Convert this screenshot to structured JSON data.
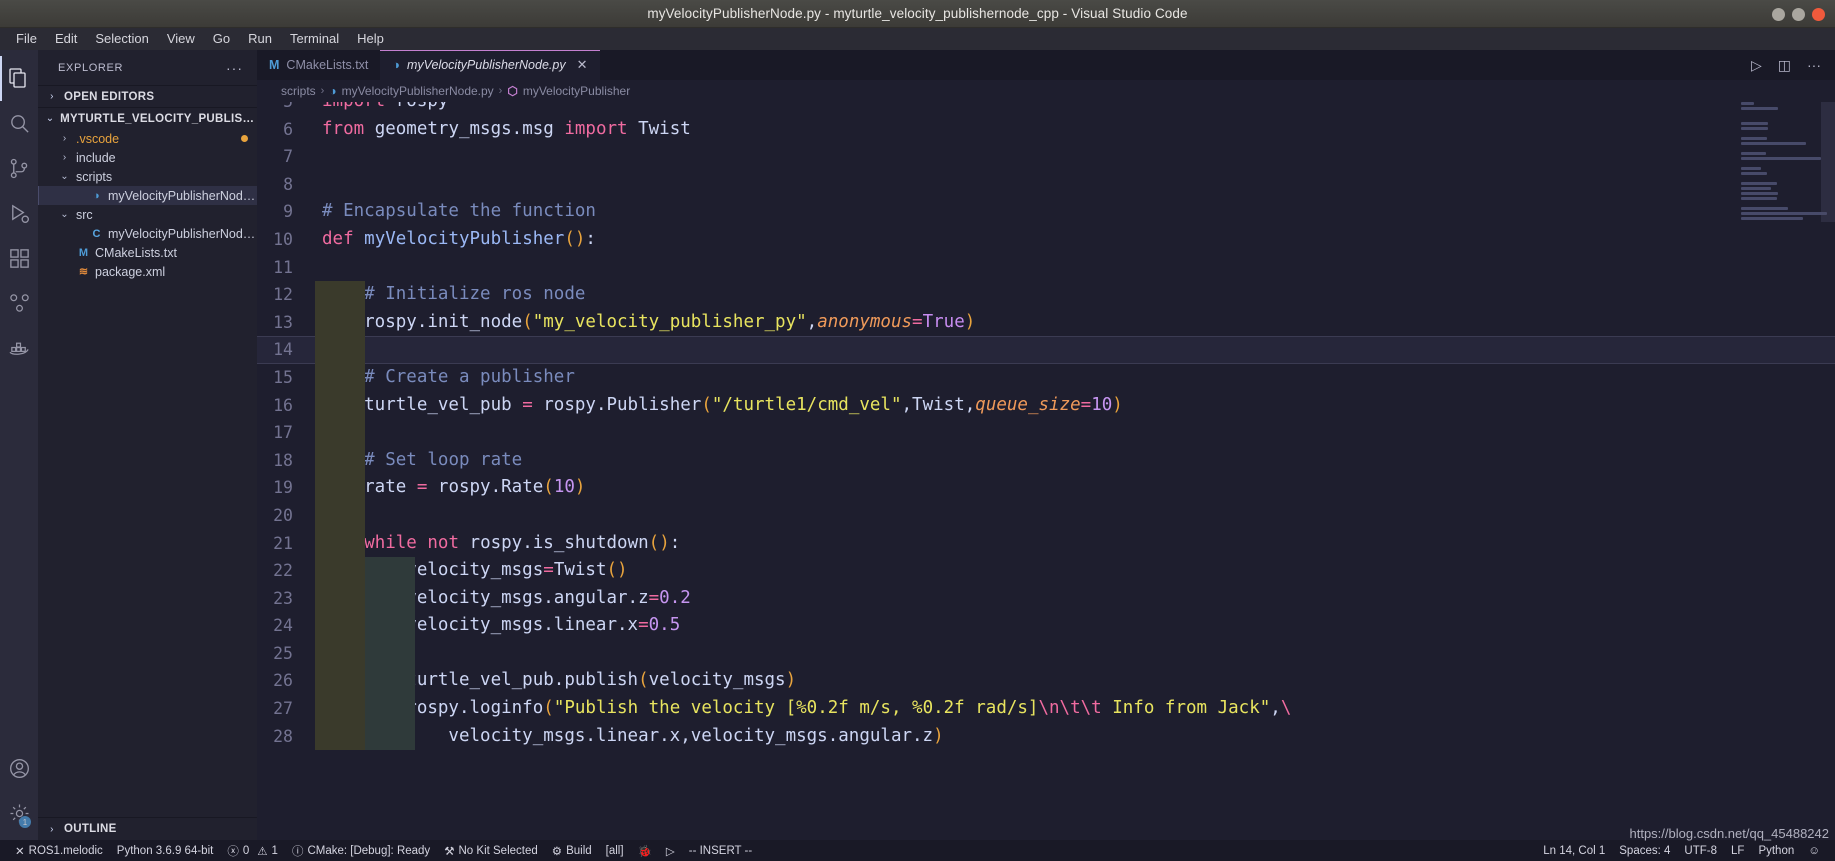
{
  "window": {
    "title": "myVelocityPublisherNode.py - myturtle_velocity_publishernode_cpp - Visual Studio Code",
    "controls": {
      "minimize": "minimize-icon",
      "maximize": "maximize-icon",
      "close": "close-icon"
    }
  },
  "menubar": {
    "items": [
      "File",
      "Edit",
      "Selection",
      "View",
      "Go",
      "Run",
      "Terminal",
      "Help"
    ]
  },
  "activitybar": {
    "items": [
      {
        "name": "explorer",
        "icon": "files-icon",
        "active": true
      },
      {
        "name": "search",
        "icon": "search-icon",
        "active": false
      },
      {
        "name": "source-control",
        "icon": "source-control-icon",
        "active": false
      },
      {
        "name": "run-and-debug",
        "icon": "run-debug-icon",
        "active": false
      },
      {
        "name": "extensions",
        "icon": "extensions-icon",
        "active": false
      },
      {
        "name": "ros",
        "icon": "ros-icon",
        "active": false
      },
      {
        "name": "docker",
        "icon": "docker-icon",
        "active": false
      }
    ],
    "bottom": [
      {
        "name": "accounts",
        "icon": "account-icon"
      },
      {
        "name": "settings",
        "icon": "gear-icon",
        "badge": "1"
      }
    ]
  },
  "sidebar": {
    "title": "EXPLORER",
    "more_label": "···",
    "sections": [
      {
        "label": "OPEN EDITORS",
        "twisty": "›",
        "expanded": false
      },
      {
        "label": "MYTURTLE_VELOCITY_PUBLISHERNODE_...",
        "twisty": "⌄",
        "expanded": true
      }
    ],
    "tree": [
      {
        "label": ".vscode",
        "type": "folder",
        "twisty": "›",
        "depth": 1,
        "icon": "folder-icon",
        "color": "#e8a33d",
        "modified": true
      },
      {
        "label": "include",
        "type": "folder",
        "twisty": "›",
        "depth": 1,
        "icon": "folder-icon",
        "color": "#cdd0df",
        "modified": false
      },
      {
        "label": "scripts",
        "type": "folder",
        "twisty": "⌄",
        "depth": 1,
        "icon": "folder-icon",
        "color": "#cdd0df",
        "modified": false
      },
      {
        "label": "myVelocityPublisherNode.py",
        "type": "file",
        "depth": 2,
        "icon": "python-icon",
        "color": "#4e9bd6",
        "selected": true
      },
      {
        "label": "src",
        "type": "folder",
        "twisty": "⌄",
        "depth": 1,
        "icon": "folder-icon",
        "color": "#cdd0df",
        "modified": false
      },
      {
        "label": "myVelocityPublisherNode.cpp",
        "type": "file",
        "depth": 2,
        "icon": "cpp-icon",
        "color": "#59a6e0",
        "selected": false
      },
      {
        "label": "CMakeLists.txt",
        "type": "file",
        "depth": 1,
        "icon": "cmake-icon",
        "color": "#4e9bd6",
        "selected": false
      },
      {
        "label": "package.xml",
        "type": "file",
        "depth": 1,
        "icon": "xml-icon",
        "color": "#e08a3c",
        "selected": false
      }
    ],
    "outline": {
      "label": "OUTLINE",
      "twisty": "›"
    }
  },
  "tabs": [
    {
      "label": "CMakeLists.txt",
      "icon": "cmake-icon",
      "icon_glyph": "M",
      "icon_color": "#4e9bd6",
      "active": false,
      "closable": false
    },
    {
      "label": "myVelocityPublisherNode.py",
      "icon": "python-icon",
      "icon_glyph": "◑",
      "icon_color": "#4e9bd6",
      "active": true,
      "closable": true,
      "close_glyph": "✕"
    }
  ],
  "editor_actions": [
    {
      "name": "run-python-file",
      "glyph": "▷"
    },
    {
      "name": "split-editor",
      "glyph": "◫"
    },
    {
      "name": "more-actions",
      "glyph": "···"
    }
  ],
  "breadcrumb": [
    {
      "label": "scripts",
      "icon": null
    },
    {
      "label": "myVelocityPublisherNode.py",
      "icon": "python-icon"
    },
    {
      "label": "myVelocityPublisher",
      "icon": "symbol-method-icon"
    }
  ],
  "breadcrumb_separator": "›",
  "code": {
    "first_visible_line": 5,
    "cursor_line": 14,
    "lines": [
      {
        "n": 5,
        "indent": 0,
        "partial": true,
        "tokens": [
          {
            "t": "import",
            "c": "kw"
          },
          {
            "t": " ",
            "c": "var"
          },
          {
            "t": "rospy",
            "c": "var"
          }
        ]
      },
      {
        "n": 6,
        "indent": 0,
        "tokens": [
          {
            "t": "from",
            "c": "kw"
          },
          {
            "t": " geometry_msgs.msg ",
            "c": "var"
          },
          {
            "t": "import",
            "c": "kw"
          },
          {
            "t": " ",
            "c": "var"
          },
          {
            "t": "Twist",
            "c": "var"
          }
        ]
      },
      {
        "n": 7,
        "indent": 0,
        "tokens": []
      },
      {
        "n": 8,
        "indent": 0,
        "tokens": []
      },
      {
        "n": 9,
        "indent": 0,
        "tokens": [
          {
            "t": "# Encapsulate the function",
            "c": "cmt"
          }
        ]
      },
      {
        "n": 10,
        "indent": 0,
        "tokens": [
          {
            "t": "def",
            "c": "kw"
          },
          {
            "t": " ",
            "c": "var"
          },
          {
            "t": "myVelocityPublisher",
            "c": "fn"
          },
          {
            "t": "()",
            "c": "par"
          },
          {
            "t": ":",
            "c": "var"
          }
        ]
      },
      {
        "n": 11,
        "indent": 0,
        "tokens": []
      },
      {
        "n": 12,
        "indent": 1,
        "tokens": [
          {
            "t": "    ",
            "c": "var"
          },
          {
            "t": "# Initialize ros node",
            "c": "cmt"
          }
        ]
      },
      {
        "n": 13,
        "indent": 1,
        "tokens": [
          {
            "t": "    rospy.init_node",
            "c": "var"
          },
          {
            "t": "(",
            "c": "par"
          },
          {
            "t": "\"my_velocity_publisher_py\"",
            "c": "str"
          },
          {
            "t": ",",
            "c": "var"
          },
          {
            "t": "anonymous",
            "c": "parm"
          },
          {
            "t": "=",
            "c": "op"
          },
          {
            "t": "True",
            "c": "kw2"
          },
          {
            "t": ")",
            "c": "par"
          }
        ]
      },
      {
        "n": 14,
        "indent": 1,
        "current": true,
        "tokens": []
      },
      {
        "n": 15,
        "indent": 1,
        "tokens": [
          {
            "t": "    ",
            "c": "var"
          },
          {
            "t": "# Create a publisher",
            "c": "cmt"
          }
        ]
      },
      {
        "n": 16,
        "indent": 1,
        "tokens": [
          {
            "t": "    turtle_vel_pub ",
            "c": "var"
          },
          {
            "t": "=",
            "c": "op"
          },
          {
            "t": " rospy.Publisher",
            "c": "var"
          },
          {
            "t": "(",
            "c": "par"
          },
          {
            "t": "\"/turtle1/cmd_vel\"",
            "c": "str"
          },
          {
            "t": ",Twist,",
            "c": "var"
          },
          {
            "t": "queue_size",
            "c": "parm"
          },
          {
            "t": "=",
            "c": "op"
          },
          {
            "t": "10",
            "c": "num"
          },
          {
            "t": ")",
            "c": "par"
          }
        ]
      },
      {
        "n": 17,
        "indent": 1,
        "tokens": []
      },
      {
        "n": 18,
        "indent": 1,
        "tokens": [
          {
            "t": "    ",
            "c": "var"
          },
          {
            "t": "# Set loop rate",
            "c": "cmt"
          }
        ]
      },
      {
        "n": 19,
        "indent": 1,
        "tokens": [
          {
            "t": "    rate ",
            "c": "var"
          },
          {
            "t": "=",
            "c": "op"
          },
          {
            "t": " rospy.Rate",
            "c": "var"
          },
          {
            "t": "(",
            "c": "par"
          },
          {
            "t": "10",
            "c": "num"
          },
          {
            "t": ")",
            "c": "par"
          }
        ]
      },
      {
        "n": 20,
        "indent": 1,
        "tokens": []
      },
      {
        "n": 21,
        "indent": 1,
        "tokens": [
          {
            "t": "    ",
            "c": "var"
          },
          {
            "t": "while",
            "c": "kw"
          },
          {
            "t": " ",
            "c": "var"
          },
          {
            "t": "not",
            "c": "kw"
          },
          {
            "t": " rospy.is_shutdown",
            "c": "var"
          },
          {
            "t": "()",
            "c": "par"
          },
          {
            "t": ":",
            "c": "var"
          }
        ]
      },
      {
        "n": 22,
        "indent": 2,
        "tokens": [
          {
            "t": "        velocity_msgs",
            "c": "var"
          },
          {
            "t": "=",
            "c": "op"
          },
          {
            "t": "Twist",
            "c": "var"
          },
          {
            "t": "()",
            "c": "par"
          }
        ]
      },
      {
        "n": 23,
        "indent": 2,
        "tokens": [
          {
            "t": "        velocity_msgs.angular.z",
            "c": "var"
          },
          {
            "t": "=",
            "c": "op"
          },
          {
            "t": "0.2",
            "c": "num"
          }
        ]
      },
      {
        "n": 24,
        "indent": 2,
        "tokens": [
          {
            "t": "        velocity_msgs.linear.x",
            "c": "var"
          },
          {
            "t": "=",
            "c": "op"
          },
          {
            "t": "0.5",
            "c": "num"
          }
        ]
      },
      {
        "n": 25,
        "indent": 2,
        "tokens": []
      },
      {
        "n": 26,
        "indent": 2,
        "tokens": [
          {
            "t": "        turtle_vel_pub.publish",
            "c": "var"
          },
          {
            "t": "(",
            "c": "par"
          },
          {
            "t": "velocity_msgs",
            "c": "var"
          },
          {
            "t": ")",
            "c": "par"
          }
        ]
      },
      {
        "n": 27,
        "indent": 2,
        "tokens": [
          {
            "t": "        rospy.loginfo",
            "c": "var"
          },
          {
            "t": "(",
            "c": "par"
          },
          {
            "t": "\"Publish the velocity [%0.2f m/s, %0.2f rad/s]",
            "c": "str"
          },
          {
            "t": "\\n\\t\\t",
            "c": "esc"
          },
          {
            "t": " Info from Jack\"",
            "c": "str"
          },
          {
            "t": ",",
            "c": "var"
          },
          {
            "t": "\\",
            "c": "esc"
          }
        ]
      },
      {
        "n": 28,
        "indent": 2,
        "partial": true,
        "tokens": [
          {
            "t": "            velocity_msgs.linear.x,velocity_msgs.angular.z",
            "c": "var"
          },
          {
            "t": ")",
            "c": "par"
          }
        ]
      }
    ]
  },
  "statusbar": {
    "left": [
      {
        "name": "ros-status",
        "glyph": "✕",
        "label": "ROS1.melodic"
      },
      {
        "name": "python-interpreter",
        "glyph": "",
        "label": "Python 3.6.9 64-bit"
      },
      {
        "name": "problems",
        "glyph": "ⓧ",
        "label": "0",
        "glyph2": "⚠",
        "label2": "1"
      },
      {
        "name": "cmake-status",
        "glyph": "ⓘ",
        "label": "CMake: [Debug]: Ready"
      },
      {
        "name": "cmake-kit",
        "glyph": "⚒",
        "label": "No Kit Selected"
      },
      {
        "name": "cmake-build",
        "glyph": "⚙",
        "label": "Build"
      },
      {
        "name": "cmake-target",
        "glyph": "",
        "label": "[all]"
      },
      {
        "name": "cmake-debug",
        "glyph": "🐞",
        "label": ""
      },
      {
        "name": "cmake-run",
        "glyph": "▷",
        "label": ""
      },
      {
        "name": "vim-mode",
        "glyph": "",
        "label": "-- INSERT --"
      }
    ],
    "right": [
      {
        "name": "cursor-position",
        "label": "Ln 14, Col 1"
      },
      {
        "name": "indentation",
        "label": "Spaces: 4"
      },
      {
        "name": "encoding",
        "label": "UTF-8"
      },
      {
        "name": "eol",
        "label": "LF"
      },
      {
        "name": "language-mode",
        "label": "Python"
      },
      {
        "name": "feedback",
        "label": "☺"
      }
    ]
  },
  "watermark": {
    "text": "https://blog.csdn.net/qq_45488242"
  }
}
